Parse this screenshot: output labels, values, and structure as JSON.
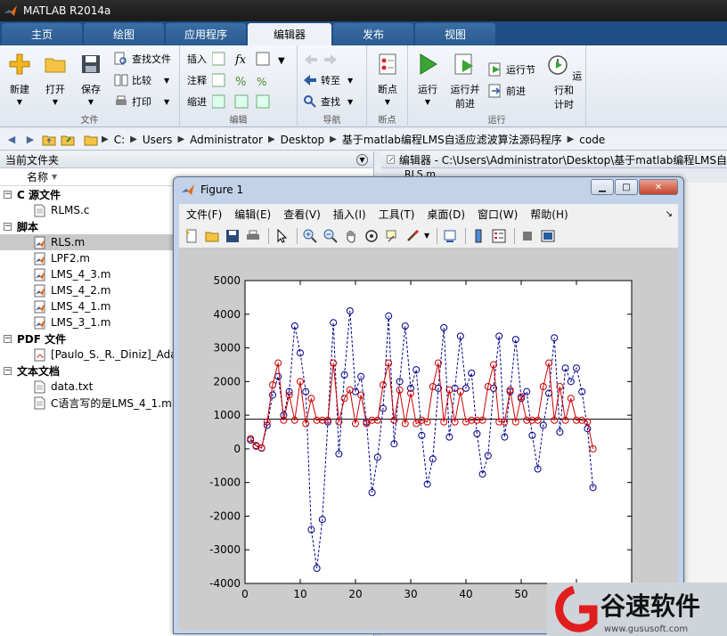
{
  "app": {
    "title": "MATLAB R2014a"
  },
  "tabs": [
    {
      "label": "主页"
    },
    {
      "label": "绘图"
    },
    {
      "label": "应用程序"
    },
    {
      "label": "编辑器"
    },
    {
      "label": "发布"
    },
    {
      "label": "视图"
    }
  ],
  "ribbon": {
    "file_group": {
      "label": "文件",
      "new": "新建",
      "open": "打开",
      "save": "保存",
      "find_files": "查找文件",
      "compare": "比较",
      "print": "打印"
    },
    "edit_group": {
      "label": "编辑",
      "insert": "插入",
      "comment": "注释",
      "indent": "缩进"
    },
    "nav_group": {
      "label": "导航",
      "goto": "转至",
      "find": "查找"
    },
    "breakpoint_group": {
      "label": "断点",
      "breakpoints": "断点"
    },
    "run_group": {
      "label": "运行",
      "run": "运行",
      "run_advance_1": "运行并",
      "run_advance_2": "前进",
      "run_section": "运行节",
      "advance": "前进",
      "run_time_1": "运行和",
      "run_time_2": "计时"
    }
  },
  "address": {
    "crumbs": [
      "C:",
      "Users",
      "Administrator",
      "Desktop",
      "基于matlab编程LMS自适应滤波算法源码程序",
      "code"
    ]
  },
  "left_panel": {
    "title": "当前文件夹",
    "column_name": "名称",
    "sections": [
      {
        "label": "C 源文件",
        "items": [
          {
            "name": "RLMS.c",
            "type": "c"
          }
        ]
      },
      {
        "label": "脚本",
        "items": [
          {
            "name": "RLS.m",
            "type": "m",
            "selected": true
          },
          {
            "name": "LPF2.m",
            "type": "m"
          },
          {
            "name": "LMS_4_3.m",
            "type": "m"
          },
          {
            "name": "LMS_4_2.m",
            "type": "m"
          },
          {
            "name": "LMS_4_1.m",
            "type": "m"
          },
          {
            "name": "LMS_3_1.m",
            "type": "m"
          }
        ]
      },
      {
        "label": "PDF 文件",
        "items": [
          {
            "name": "[Paulo_S._R._Diniz]_Adap",
            "type": "pdf"
          }
        ]
      },
      {
        "label": "文本文档",
        "items": [
          {
            "name": "data.txt",
            "type": "txt"
          },
          {
            "name": "C语言写的是LMS_4_1.m",
            "type": "txt"
          }
        ]
      }
    ]
  },
  "editor": {
    "title": "编辑器 - C:\\Users\\Administrator\\Desktop\\基于matlab编程LMS自",
    "tab": "RLS.m"
  },
  "figure": {
    "title": "Figure 1",
    "menu": [
      "文件(F)",
      "编辑(E)",
      "查看(V)",
      "插入(I)",
      "工具(T)",
      "桌面(D)",
      "窗口(W)",
      "帮助(H)"
    ]
  },
  "chart_data": {
    "type": "line",
    "xlim": [
      0,
      70
    ],
    "ylim": [
      -4000,
      5000
    ],
    "xticks": [
      0,
      10,
      20,
      30,
      40,
      50,
      60,
      70
    ],
    "yticks": [
      -4000,
      -3000,
      -2000,
      -1000,
      0,
      1000,
      2000,
      3000,
      4000,
      5000
    ],
    "grid": false,
    "hline": 880,
    "series": [
      {
        "style": "dashed-circle",
        "color": "#00008b",
        "x": [
          1,
          2,
          3,
          4,
          5,
          6,
          7,
          8,
          9,
          10,
          11,
          12,
          13,
          14,
          15,
          16,
          17,
          18,
          19,
          20,
          21,
          22,
          23,
          24,
          25,
          26,
          27,
          28,
          29,
          30,
          31,
          32,
          33,
          34,
          35,
          36,
          37,
          38,
          39,
          40,
          41,
          42,
          43,
          44,
          45,
          46,
          47,
          48,
          49,
          50,
          51,
          52,
          53,
          54,
          55,
          56,
          57,
          58,
          59,
          60,
          61,
          62,
          63
        ],
        "y": [
          260,
          80,
          20,
          700,
          1600,
          2150,
          1000,
          1700,
          3650,
          2850,
          1700,
          -2400,
          -3550,
          -2100,
          800,
          3750,
          -150,
          2200,
          4100,
          1700,
          2150,
          800,
          -1300,
          -250,
          1200,
          3950,
          150,
          2000,
          3650,
          1800,
          2350,
          400,
          -1050,
          -300,
          1800,
          3600,
          350,
          1800,
          3350,
          1800,
          2250,
          450,
          -750,
          -200,
          1800,
          3350,
          350,
          1700,
          3250,
          1500,
          1700,
          400,
          -600,
          700,
          1650,
          3300,
          500,
          2400,
          2000,
          2400,
          1700,
          600,
          -1150
        ]
      },
      {
        "style": "solid-circle",
        "color": "#cc0000",
        "x": [
          1,
          2,
          3,
          4,
          5,
          6,
          7,
          8,
          9,
          10,
          11,
          12,
          13,
          14,
          15,
          16,
          17,
          18,
          19,
          20,
          21,
          22,
          23,
          24,
          25,
          26,
          27,
          28,
          29,
          30,
          31,
          32,
          33,
          34,
          35,
          36,
          37,
          38,
          39,
          40,
          41,
          42,
          43,
          44,
          45,
          46,
          47,
          48,
          49,
          50,
          51,
          52,
          53,
          54,
          55,
          56,
          57,
          58,
          59,
          60,
          61,
          62,
          63
        ],
        "y": [
          300,
          100,
          30,
          800,
          1900,
          2550,
          850,
          1600,
          850,
          2000,
          750,
          1500,
          850,
          850,
          850,
          2550,
          800,
          1500,
          1750,
          750,
          1600,
          750,
          850,
          850,
          1900,
          2550,
          850,
          1750,
          750,
          1650,
          750,
          850,
          800,
          1850,
          2550,
          800,
          1750,
          800,
          1700,
          800,
          850,
          850,
          850,
          1850,
          2500,
          800,
          800,
          1750,
          800,
          1550,
          850,
          850,
          850,
          1850,
          2550,
          850,
          1850,
          850,
          1500,
          850,
          850,
          800,
          0
        ]
      }
    ]
  },
  "watermark": {
    "text": "谷速软件",
    "url": "www.gususoft.com"
  }
}
